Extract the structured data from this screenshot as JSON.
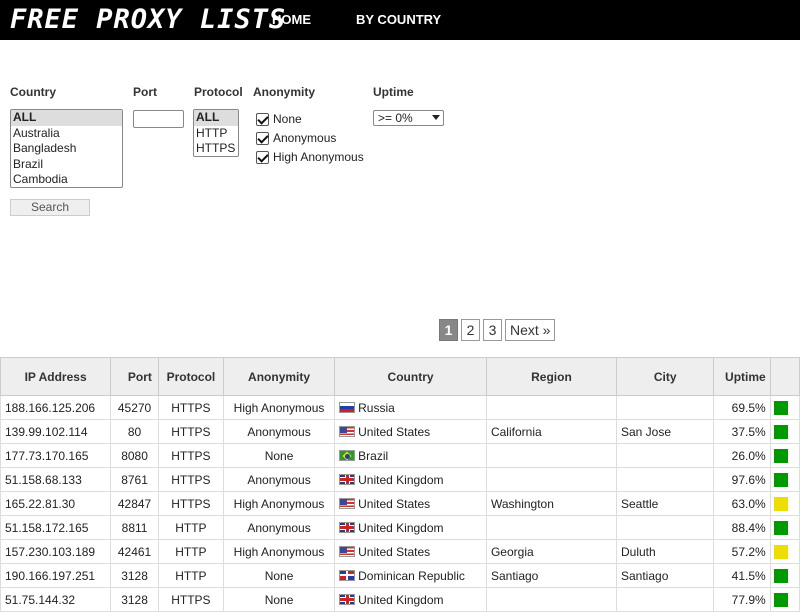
{
  "header": {
    "logo": "FREE PROXY LISTS",
    "nav": [
      {
        "label": "HOME"
      },
      {
        "label": "BY COUNTRY"
      }
    ]
  },
  "filters": {
    "country": {
      "label": "Country",
      "options": [
        "ALL",
        "Australia",
        "Bangladesh",
        "Brazil",
        "Cambodia"
      ],
      "selected": "ALL"
    },
    "port": {
      "label": "Port",
      "value": ""
    },
    "protocol": {
      "label": "Protocol",
      "options": [
        "ALL",
        "HTTP",
        "HTTPS"
      ],
      "selected": "ALL"
    },
    "anonymity": {
      "label": "Anonymity",
      "options": [
        {
          "label": "None",
          "checked": true
        },
        {
          "label": "Anonymous",
          "checked": true
        },
        {
          "label": "High Anonymous",
          "checked": true
        }
      ]
    },
    "uptime": {
      "label": "Uptime",
      "selected": ">= 0%"
    },
    "search_label": "Search"
  },
  "pagination": {
    "pages": [
      "1",
      "2",
      "3"
    ],
    "current": "1",
    "next_label": "Next »"
  },
  "table": {
    "headers": [
      "IP Address",
      "Port",
      "Protocol",
      "Anonymity",
      "Country",
      "Region",
      "City",
      "Uptime"
    ],
    "colors": {
      "good": "#009900",
      "medium": "#eedd00"
    },
    "rows": [
      {
        "ip": "188.166.125.206",
        "port": "45270",
        "protocol": "HTTPS",
        "anonymity": "High Anonymous",
        "flag": "ru-flag-icon",
        "country": "Russia",
        "region": "",
        "city": "",
        "uptime": "69.5%",
        "speed": "good"
      },
      {
        "ip": "139.99.102.114",
        "port": "80",
        "protocol": "HTTPS",
        "anonymity": "Anonymous",
        "flag": "us-flag-icon",
        "country": "United States",
        "region": "California",
        "city": "San Jose",
        "uptime": "37.5%",
        "speed": "good"
      },
      {
        "ip": "177.73.170.165",
        "port": "8080",
        "protocol": "HTTPS",
        "anonymity": "None",
        "flag": "br-flag-icon",
        "country": "Brazil",
        "region": "",
        "city": "",
        "uptime": "26.0%",
        "speed": "good"
      },
      {
        "ip": "51.158.68.133",
        "port": "8761",
        "protocol": "HTTPS",
        "anonymity": "Anonymous",
        "flag": "gb-flag-icon",
        "country": "United Kingdom",
        "region": "",
        "city": "",
        "uptime": "97.6%",
        "speed": "good"
      },
      {
        "ip": "165.22.81.30",
        "port": "42847",
        "protocol": "HTTPS",
        "anonymity": "High Anonymous",
        "flag": "us-flag-icon",
        "country": "United States",
        "region": "Washington",
        "city": "Seattle",
        "uptime": "63.0%",
        "speed": "medium"
      },
      {
        "ip": "51.158.172.165",
        "port": "8811",
        "protocol": "HTTP",
        "anonymity": "Anonymous",
        "flag": "gb-flag-icon",
        "country": "United Kingdom",
        "region": "",
        "city": "",
        "uptime": "88.4%",
        "speed": "good"
      },
      {
        "ip": "157.230.103.189",
        "port": "42461",
        "protocol": "HTTP",
        "anonymity": "High Anonymous",
        "flag": "us-flag-icon",
        "country": "United States",
        "region": "Georgia",
        "city": "Duluth",
        "uptime": "57.2%",
        "speed": "medium"
      },
      {
        "ip": "190.166.197.251",
        "port": "3128",
        "protocol": "HTTP",
        "anonymity": "None",
        "flag": "do-flag-icon",
        "country": "Dominican Republic",
        "region": "Santiago",
        "city": "Santiago",
        "uptime": "41.5%",
        "speed": "good"
      },
      {
        "ip": "51.75.144.32",
        "port": "3128",
        "protocol": "HTTPS",
        "anonymity": "None",
        "flag": "gb-flag-icon",
        "country": "United Kingdom",
        "region": "",
        "city": "",
        "uptime": "77.9%",
        "speed": "good"
      }
    ]
  }
}
